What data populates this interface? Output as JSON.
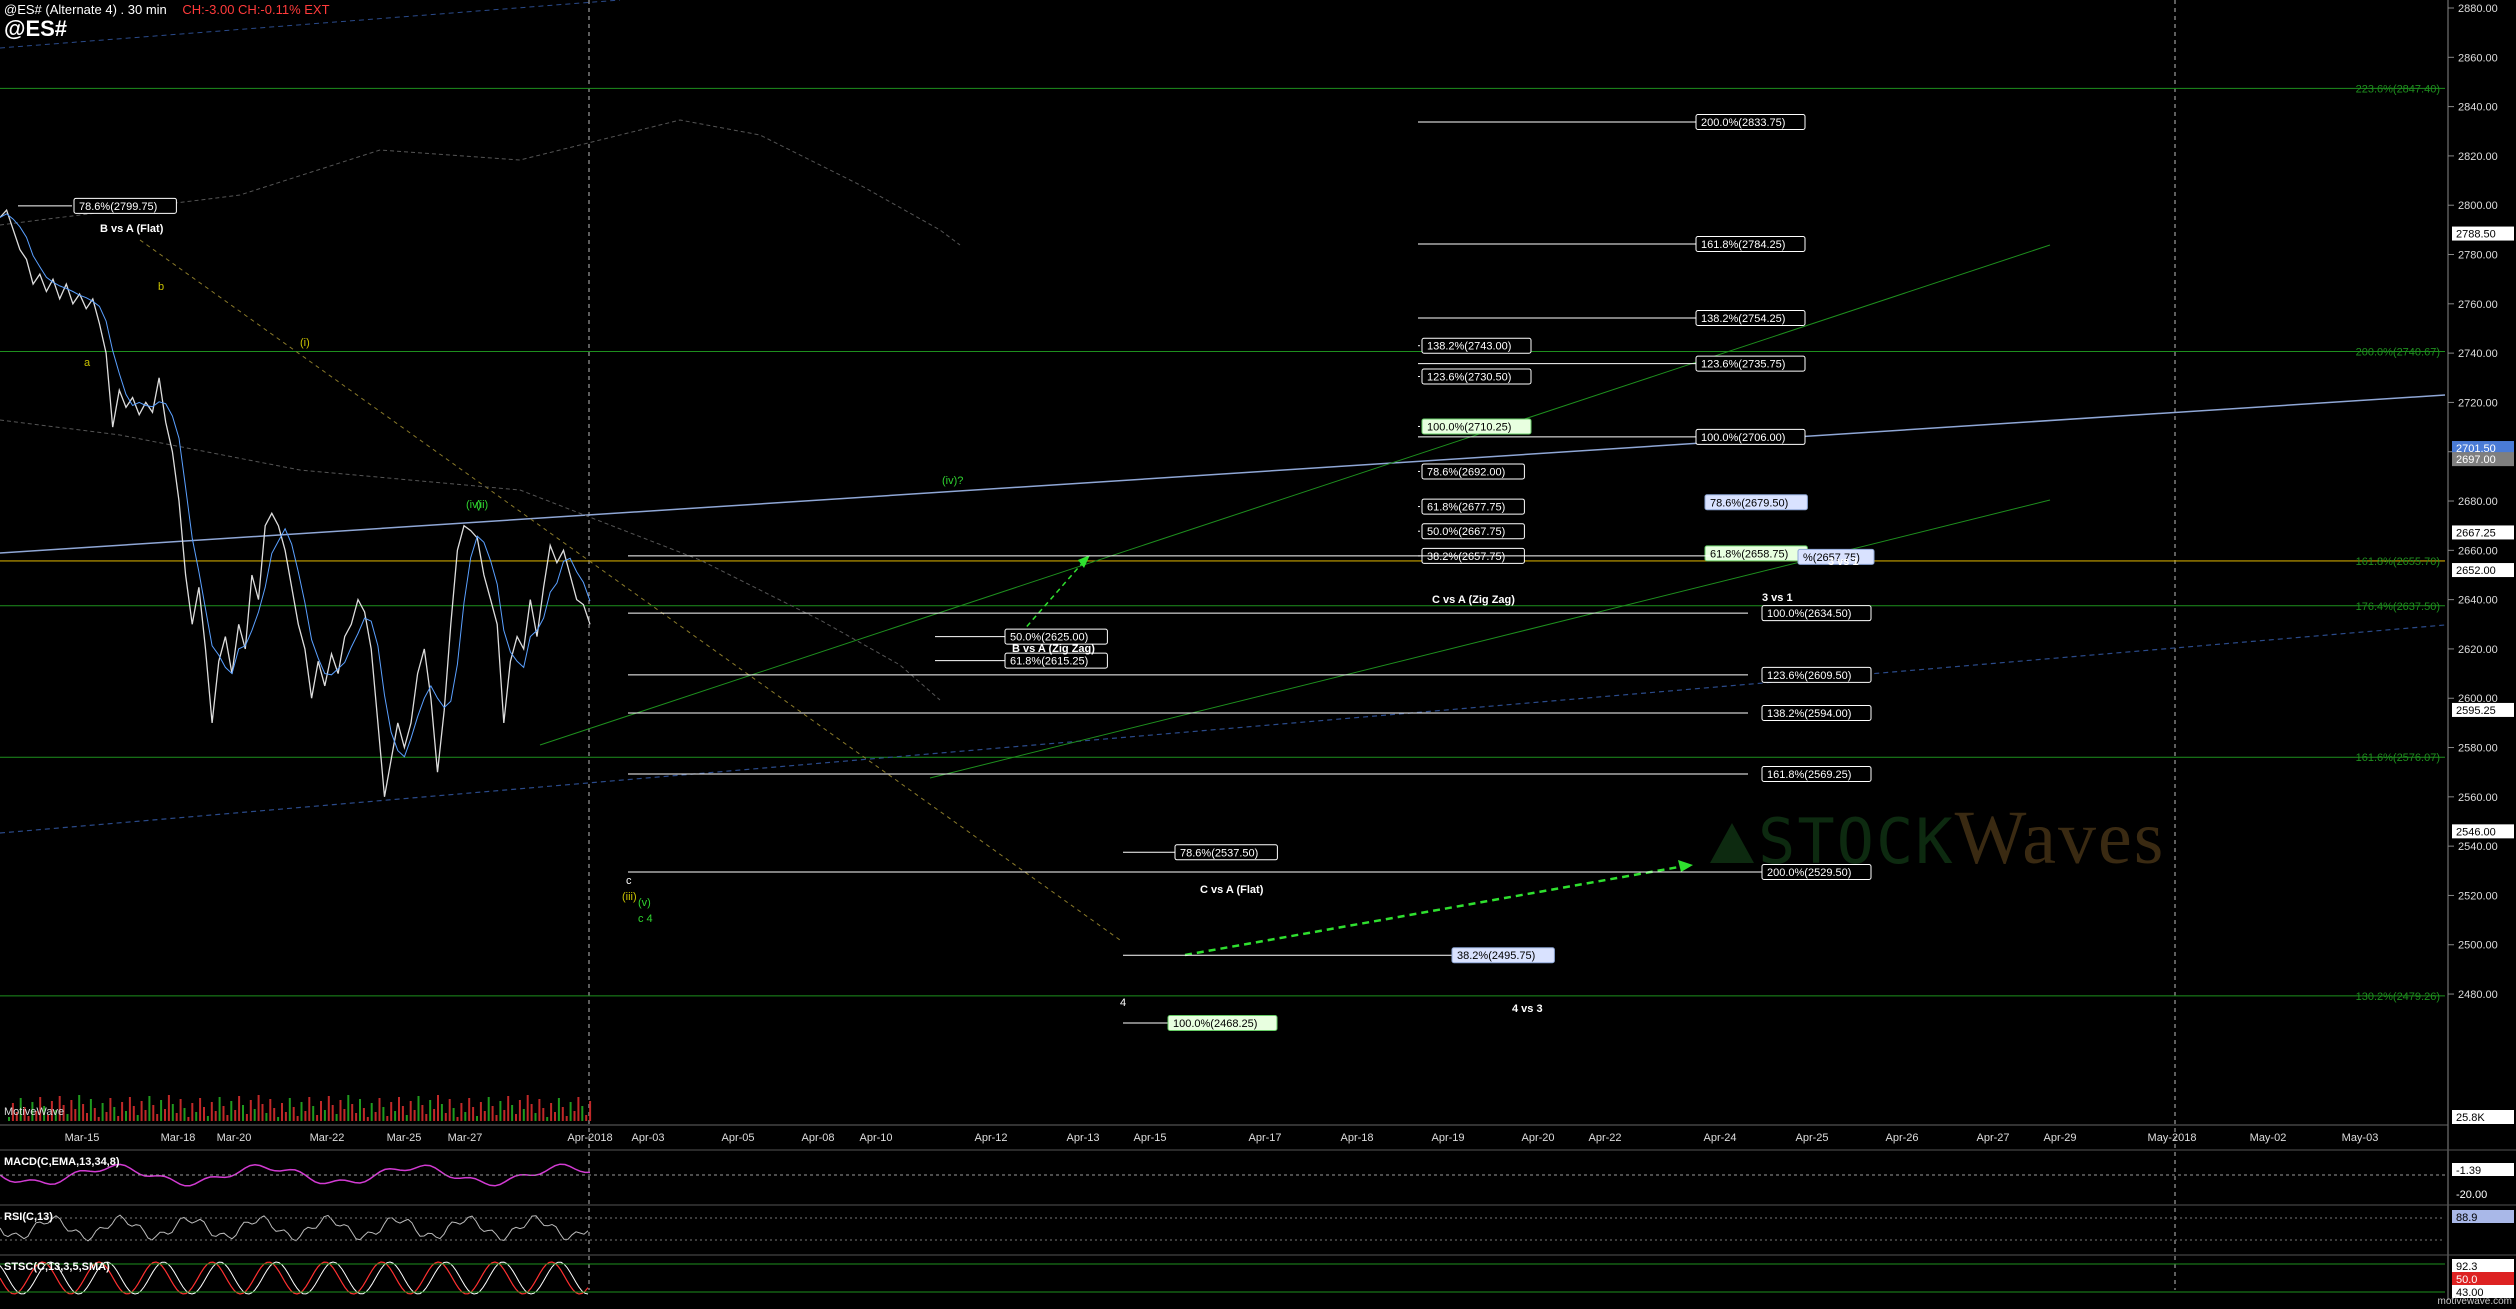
{
  "header": {
    "title": "@ES# (Alternate 4) . 30 min",
    "change": "CH:-3.00  CH:-0.11%  EXT",
    "symbol": "@ES#"
  },
  "watermark": {
    "brand_left": "STOCK",
    "brand_right": "Waves"
  },
  "motivewave": "MotiveWave",
  "footer": "motivewave.com",
  "indicators": {
    "macd": "MACD(C,EMA,13,34,8)",
    "rsi": "RSI(C,13)",
    "stsc": "STSC(C,13,3,5,SMA)"
  },
  "colors": {
    "background": "#000000",
    "price": "#ffffff",
    "fib_line": "#ffffff",
    "green_line": "#1e8f1e",
    "blue_line": "#8fa7d6",
    "gold_line": "#c9a400",
    "label_bg": "#000000",
    "macd_line": "#d23bd2"
  },
  "chart_data": {
    "type": "line",
    "title": "@ES# (Alternate 4) . 30 min",
    "ylim": [
      2450,
      2880
    ],
    "y_axis_ticks": [
      "2880.00",
      "2860.00",
      "2840.00",
      "2820.00",
      "2800.00",
      "2780.00",
      "2760.00",
      "2740.00",
      "2720.00",
      "2700.00",
      "2680.00",
      "2660.00",
      "2640.00",
      "2620.00",
      "2600.00",
      "2580.00",
      "2560.00",
      "2540.00",
      "2520.00",
      "2500.00",
      "2480.00"
    ],
    "x_axis_ticks": [
      "Mar-15",
      "Mar-18",
      "Mar-20",
      "Mar-22",
      "Mar-25",
      "Mar-27",
      "Apr-2018",
      "Apr-03",
      "Apr-05",
      "Apr-08",
      "Apr-10",
      "Apr-12",
      "Apr-13",
      "Apr-15",
      "Apr-17",
      "Apr-18",
      "Apr-19",
      "Apr-20",
      "Apr-22",
      "Apr-24",
      "Apr-25",
      "Apr-26",
      "Apr-27",
      "Apr-29",
      "May-2018",
      "May-02",
      "May-03"
    ],
    "price_path": [
      [
        0,
        2795
      ],
      [
        0.5,
        2798
      ],
      [
        1,
        2790
      ],
      [
        1.5,
        2782
      ],
      [
        2,
        2778
      ],
      [
        2.5,
        2768
      ],
      [
        3,
        2772
      ],
      [
        3.5,
        2765
      ],
      [
        4,
        2770
      ],
      [
        4.5,
        2762
      ],
      [
        5,
        2768
      ],
      [
        5.5,
        2760
      ],
      [
        6,
        2764
      ],
      [
        6.5,
        2758
      ],
      [
        7,
        2762
      ],
      [
        7.5,
        2752
      ],
      [
        8,
        2740
      ],
      [
        8.5,
        2710
      ],
      [
        9,
        2725
      ],
      [
        9.5,
        2718
      ],
      [
        10,
        2722
      ],
      [
        10.5,
        2715
      ],
      [
        11,
        2720
      ],
      [
        11.5,
        2716
      ],
      [
        12,
        2730
      ],
      [
        12.5,
        2712
      ],
      [
        13,
        2700
      ],
      [
        13.5,
        2680
      ],
      [
        14,
        2650
      ],
      [
        14.5,
        2630
      ],
      [
        15,
        2645
      ],
      [
        15.5,
        2620
      ],
      [
        16,
        2590
      ],
      [
        16.5,
        2615
      ],
      [
        17,
        2625
      ],
      [
        17.5,
        2610
      ],
      [
        18,
        2630
      ],
      [
        18.5,
        2620
      ],
      [
        19,
        2650
      ],
      [
        19.5,
        2640
      ],
      [
        20,
        2670
      ],
      [
        20.5,
        2675
      ],
      [
        21,
        2670
      ],
      [
        21.5,
        2660
      ],
      [
        22,
        2645
      ],
      [
        22.5,
        2630
      ],
      [
        23,
        2620
      ],
      [
        23.5,
        2600
      ],
      [
        24,
        2615
      ],
      [
        24.5,
        2605
      ],
      [
        25,
        2618
      ],
      [
        25.5,
        2610
      ],
      [
        26,
        2625
      ],
      [
        26.5,
        2630
      ],
      [
        27,
        2640
      ],
      [
        27.5,
        2635
      ],
      [
        28,
        2620
      ],
      [
        28.5,
        2590
      ],
      [
        29,
        2560
      ],
      [
        29.5,
        2575
      ],
      [
        30,
        2590
      ],
      [
        30.5,
        2580
      ],
      [
        31,
        2590
      ],
      [
        31.5,
        2610
      ],
      [
        32,
        2620
      ],
      [
        32.5,
        2600
      ],
      [
        33,
        2570
      ],
      [
        33.5,
        2595
      ],
      [
        34,
        2630
      ],
      [
        34.5,
        2660
      ],
      [
        35,
        2670
      ],
      [
        35.5,
        2668
      ],
      [
        36,
        2665
      ],
      [
        36.5,
        2650
      ],
      [
        37,
        2640
      ],
      [
        37.5,
        2630
      ],
      [
        38,
        2590
      ],
      [
        38.5,
        2615
      ],
      [
        39,
        2625
      ],
      [
        39.5,
        2620
      ],
      [
        40,
        2640
      ],
      [
        40.5,
        2625
      ],
      [
        41,
        2645
      ],
      [
        41.5,
        2662
      ],
      [
        42,
        2655
      ],
      [
        42.5,
        2660
      ],
      [
        43,
        2650
      ],
      [
        43.5,
        2640
      ],
      [
        44,
        2638
      ],
      [
        44.5,
        2630
      ]
    ],
    "price_x_range": [
      0,
      44.5
    ],
    "price_px_range": [
      0,
      590
    ],
    "fib_levels_right": [
      {
        "label": "200.0%(2833.75)",
        "value": 2833.75
      },
      {
        "label": "161.8%(2784.25)",
        "value": 2784.25
      },
      {
        "label": "138.2%(2754.25)",
        "value": 2754.25
      },
      {
        "label": "123.6%(2735.75)",
        "value": 2735.75
      },
      {
        "label": "100.0%(2706.00)",
        "value": 2706.0
      },
      {
        "label": "100.0%(2634.50)",
        "value": 2634.5
      },
      {
        "label": "123.6%(2609.50)",
        "value": 2609.5
      },
      {
        "label": "138.2%(2594.00)",
        "value": 2594.0
      },
      {
        "label": "161.8%(2569.25)",
        "value": 2569.25
      },
      {
        "label": "200.0%(2529.50)",
        "value": 2529.5
      }
    ],
    "fib_levels_middle": [
      {
        "label": "138.2%(2743.00)",
        "value": 2743.0
      },
      {
        "label": "123.6%(2730.50)",
        "value": 2730.5
      },
      {
        "label": "100.0%(2710.25)",
        "value": 2710.25,
        "highlight": "green"
      },
      {
        "label": "78.6%(2692.00)",
        "value": 2692.0
      },
      {
        "label": "61.8%(2677.75)",
        "value": 2677.75
      },
      {
        "label": "50.0%(2667.75)",
        "value": 2667.75
      },
      {
        "label": "38.2%(2657.75)",
        "value": 2657.75
      }
    ],
    "fib_levels_misc": [
      {
        "label": "78.6%(2679.50)",
        "value": 2679.5,
        "highlight": "blue"
      },
      {
        "label": "61.8%(2658.75)",
        "value": 2658.75,
        "highlight": "green"
      },
      {
        "label": "%(2657.75)",
        "value": 2657.75,
        "highlight": "blue"
      },
      {
        "label": "50.0%(2625.00)",
        "value": 2625.0
      },
      {
        "label": "61.8%(2615.25)",
        "value": 2615.25
      },
      {
        "label": "78.6%(2537.50)",
        "value": 2537.5
      },
      {
        "label": "38.2%(2495.75)",
        "value": 2495.75,
        "highlight": "blue"
      },
      {
        "label": "100.0%(2468.25)",
        "value": 2468.25,
        "highlight": "green"
      },
      {
        "label": "78.6%(2799.75)",
        "value": 2799.75
      }
    ],
    "annotations": [
      "B vs A (Flat)",
      "B vs A (Zig Zag)",
      "C vs A (Zig Zag)",
      "C vs A (Flat)",
      "3 vs 1",
      "3 vs 1",
      "4 vs 3"
    ],
    "wave_labels": [
      "(i)",
      "(ii)",
      "(iii)",
      "(iv)",
      "(v)",
      "(iv)?",
      "a",
      "b",
      "c",
      "4",
      "c 4"
    ],
    "extension_labels_right": [
      "223.6%(2847.40)",
      "200.0%(2740.67)",
      "161.8%(2655.70)",
      "176.4%(2637.50)",
      "161.6%(2576.07)",
      "130.2%(2479.26)"
    ],
    "right_price_tags": [
      {
        "label": "2788.50",
        "value": 2788.5,
        "color": "#ffffff"
      },
      {
        "label": "2701.50",
        "value": 2701.5,
        "color": "#4a7bd6"
      },
      {
        "label": "2697.00",
        "value": 2697.0,
        "color": "#7f7f7f"
      },
      {
        "label": "2667.25",
        "value": 2667.25,
        "color": "#ffffff"
      },
      {
        "label": "2652.00",
        "value": 2652.0,
        "color": "#ffffff"
      },
      {
        "label": "2595.25",
        "value": 2595.25,
        "color": "#ffffff"
      },
      {
        "label": "2546.00",
        "value": 2546.0,
        "color": "#ffffff"
      }
    ],
    "volume_tag": "25.8K",
    "macd_tags": [
      "-1.39",
      "-20.00"
    ],
    "rsi_tag": "88.9",
    "stsc_tags": [
      "92.3",
      "50.0",
      "43.00"
    ]
  }
}
